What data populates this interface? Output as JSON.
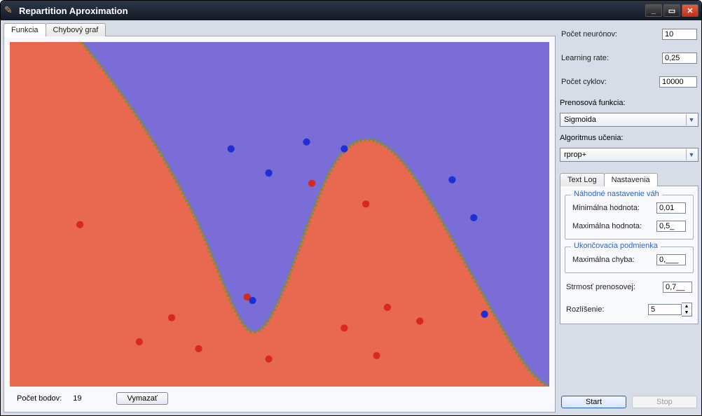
{
  "window": {
    "title": "Repartition Aproximation"
  },
  "tabs": [
    {
      "label": "Funkcia",
      "active": true
    },
    {
      "label": "Chybový graf",
      "active": false
    }
  ],
  "colors": {
    "region_a": "#e86950",
    "region_b": "#7a6dd8",
    "boundary": "#7b8f33",
    "point_a": "#d8291f",
    "point_b": "#1f2fd8"
  },
  "bottom": {
    "points_label": "Počet bodov:",
    "points_value": "19",
    "clear_button": "Vymazať"
  },
  "sidebar": {
    "neurons_label": "Počet neurónov:",
    "neurons_value": "10",
    "lr_label": "Learning rate:",
    "lr_value": "0,25",
    "cycles_label": "Počet cyklov:",
    "cycles_value": "10000",
    "transfer_label": "Prenosová funkcia:",
    "transfer_value": "Sigmoida",
    "algo_label": "Algoritmus učenia:",
    "algo_value": "rprop+"
  },
  "subtabs": [
    {
      "label": "Text Log",
      "active": false
    },
    {
      "label": "Nastavenia",
      "active": true
    }
  ],
  "settings": {
    "weights_legend": "Náhodné nastavenie váh",
    "min_label": "Minimálna hodnota:",
    "min_value": "0,01",
    "max_label": "Maximálna hodnota:",
    "max_value": "0,5_",
    "stop_legend": "Ukončovacia podmienka",
    "maxerr_label": "Maximálna chyba:",
    "maxerr_value": "0,___",
    "steep_label": "Strmosť prenosovej:",
    "steep_value": "0,7__",
    "res_label": "Rozlíšenie:",
    "res_value": "5"
  },
  "actions": {
    "start": "Start",
    "stop": "Stop"
  },
  "chart_data": {
    "type": "scatter",
    "xlim": [
      0,
      1
    ],
    "ylim": [
      0,
      1
    ],
    "series": [
      {
        "name": "class-red",
        "color": "#d8291f",
        "points": [
          [
            0.13,
            0.47
          ],
          [
            0.24,
            0.13
          ],
          [
            0.3,
            0.2
          ],
          [
            0.35,
            0.11
          ],
          [
            0.44,
            0.26
          ],
          [
            0.48,
            0.08
          ],
          [
            0.56,
            0.59
          ],
          [
            0.62,
            0.17
          ],
          [
            0.66,
            0.53
          ],
          [
            0.68,
            0.09
          ],
          [
            0.7,
            0.23
          ],
          [
            0.76,
            0.19
          ]
        ]
      },
      {
        "name": "class-blue",
        "color": "#1f2fd8",
        "points": [
          [
            0.41,
            0.69
          ],
          [
            0.45,
            0.25
          ],
          [
            0.48,
            0.62
          ],
          [
            0.55,
            0.71
          ],
          [
            0.62,
            0.69
          ],
          [
            0.82,
            0.6
          ],
          [
            0.86,
            0.49
          ],
          [
            0.88,
            0.21
          ]
        ]
      }
    ]
  }
}
